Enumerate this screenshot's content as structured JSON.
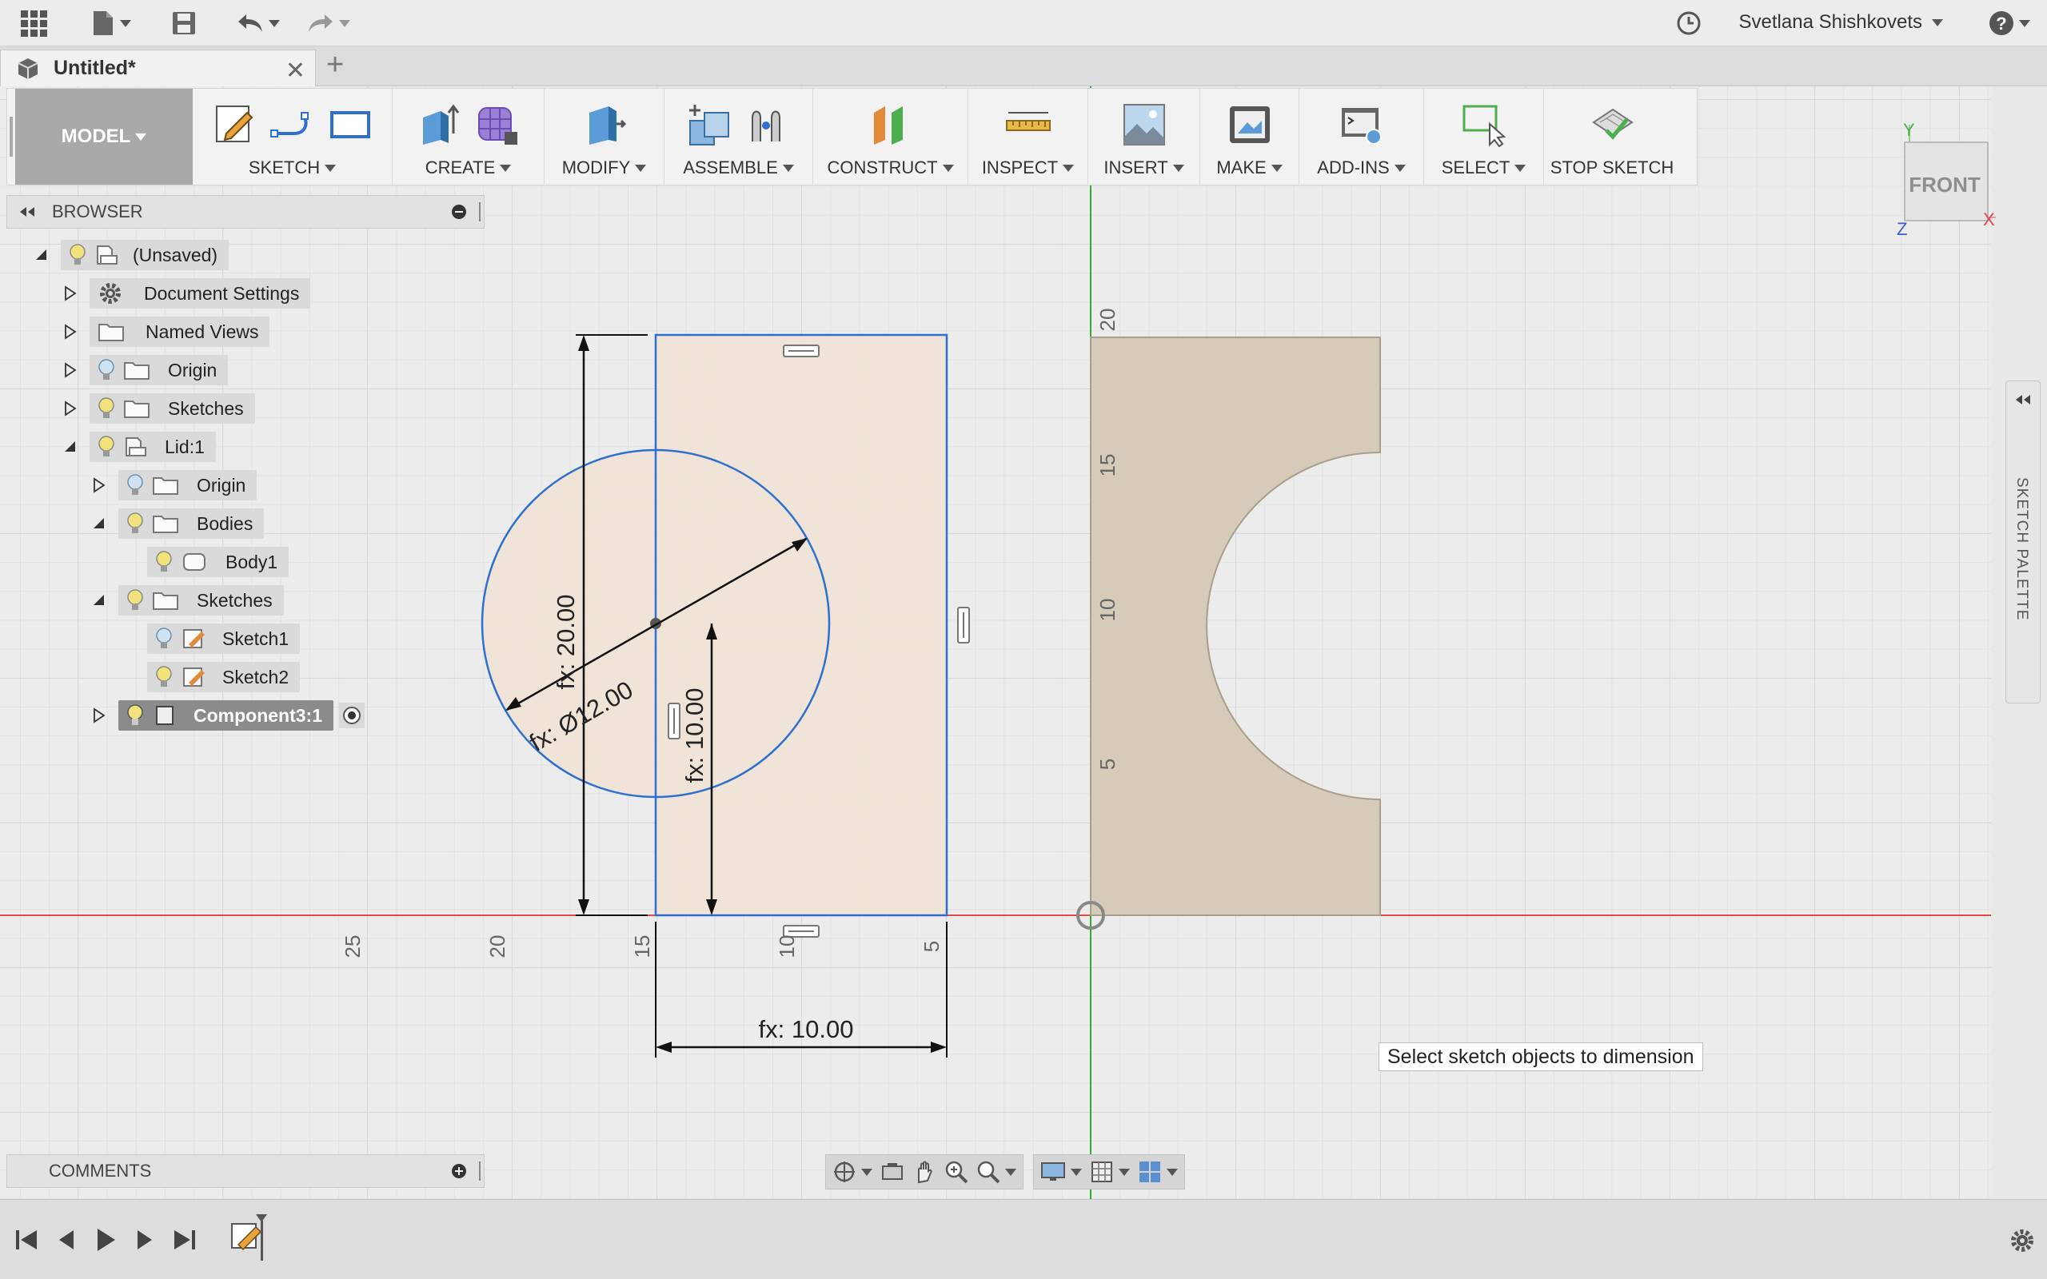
{
  "topbar": {
    "user_name": "Svetlana Shishkovets",
    "help_label": "?"
  },
  "tabs": [
    {
      "label": "Untitled*"
    }
  ],
  "toolbar": {
    "workspace": "MODEL",
    "groups": [
      "SKETCH",
      "CREATE",
      "MODIFY",
      "ASSEMBLE",
      "CONSTRUCT",
      "INSPECT",
      "INSERT",
      "MAKE",
      "ADD-INS",
      "SELECT",
      "STOP SKETCH"
    ]
  },
  "browser": {
    "title": "BROWSER",
    "nodes": [
      {
        "label": "(Unsaved)"
      },
      {
        "label": "Document Settings"
      },
      {
        "label": "Named Views"
      },
      {
        "label": "Origin"
      },
      {
        "label": "Sketches"
      },
      {
        "label": "Lid:1"
      },
      {
        "label": "Origin"
      },
      {
        "label": "Bodies"
      },
      {
        "label": "Body1"
      },
      {
        "label": "Sketches"
      },
      {
        "label": "Sketch1"
      },
      {
        "label": "Sketch2"
      },
      {
        "label": "Component3:1"
      }
    ]
  },
  "comments": {
    "title": "COMMENTS"
  },
  "canvas": {
    "dimensions": {
      "height": "fx: 20.00",
      "diameter": "fx: Ø12.00",
      "center_height": "fx: 10.00",
      "width": "fx: 10.00"
    },
    "x_ticks": [
      "25",
      "20",
      "15",
      "10",
      "5"
    ],
    "y_ticks": [
      "20",
      "15",
      "10",
      "5"
    ],
    "tooltip": "Select sketch objects to dimension"
  },
  "viewcube": {
    "face": "FRONT",
    "axis_x": "X",
    "axis_y": "Y",
    "axis_z": "Z"
  },
  "sketch_palette": {
    "title": "SKETCH PALETTE"
  },
  "colors": {
    "accent_blue": "#2f6fd0",
    "axis_red": "#e34848",
    "axis_green": "#2faa34",
    "sketch_fill": "#f0e3d4",
    "body_fill": "#d6cab8"
  }
}
